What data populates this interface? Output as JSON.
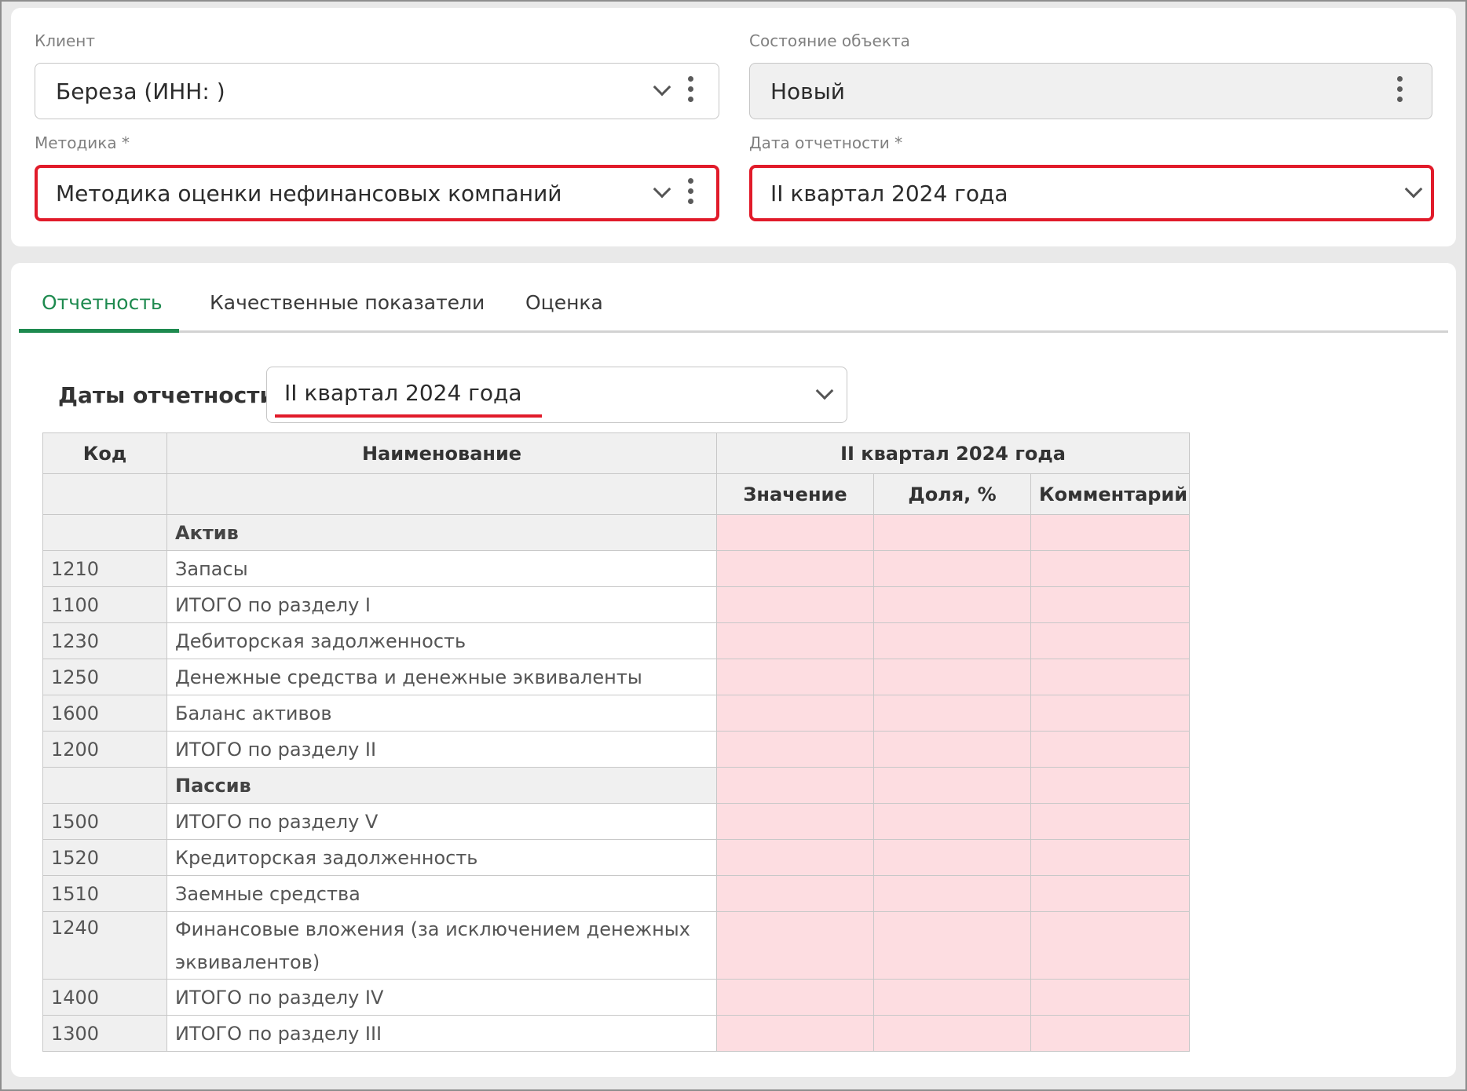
{
  "form": {
    "client": {
      "label": "Клиент",
      "value": "Береза (ИНН: )"
    },
    "state": {
      "label": "Состояние объекта",
      "value": "Новый"
    },
    "methodology": {
      "label": "Методика *",
      "value": "Методика оценки нефинансовых компаний"
    },
    "report_date": {
      "label": "Дата отчетности *",
      "value": "II квартал 2024 года"
    }
  },
  "tabs": [
    {
      "label": "Отчетность",
      "active": true
    },
    {
      "label": "Качественные показатели",
      "active": false
    },
    {
      "label": "Оценка",
      "active": false
    }
  ],
  "dates": {
    "label": "Даты отчетности",
    "value": "II квартал 2024 года"
  },
  "table": {
    "headers": {
      "code": "Код",
      "name": "Наименование",
      "period": "II квартал 2024 года",
      "value": "Значение",
      "share": "Доля, %",
      "comment": "Комментарий"
    },
    "rows": [
      {
        "type": "section",
        "code": "",
        "name": "Актив"
      },
      {
        "type": "item",
        "code": "1210",
        "name": "Запасы"
      },
      {
        "type": "item",
        "code": "1100",
        "name": "ИТОГО по разделу I"
      },
      {
        "type": "item",
        "code": "1230",
        "name": "Дебиторская задолженность"
      },
      {
        "type": "item",
        "code": "1250",
        "name": "Денежные средства и денежные эквиваленты"
      },
      {
        "type": "item",
        "code": "1600",
        "name": "Баланс активов"
      },
      {
        "type": "item",
        "code": "1200",
        "name": "ИТОГО по разделу II"
      },
      {
        "type": "section",
        "code": "",
        "name": "Пассив"
      },
      {
        "type": "item",
        "code": "1500",
        "name": "ИТОГО по разделу V"
      },
      {
        "type": "item",
        "code": "1520",
        "name": "Кредиторская задолженность"
      },
      {
        "type": "item",
        "code": "1510",
        "name": "Заемные средства"
      },
      {
        "type": "item",
        "code": "1240",
        "name": "Финансовые вложения (за исключением денежных эквивалентов)"
      },
      {
        "type": "item",
        "code": "1400",
        "name": "ИТОГО по разделу IV"
      },
      {
        "type": "item",
        "code": "1300",
        "name": "ИТОГО по разделу III"
      }
    ]
  },
  "colors": {
    "accent": "#1e8a4f",
    "error": "#e11b2a",
    "empty_cell": "#fddde1"
  }
}
